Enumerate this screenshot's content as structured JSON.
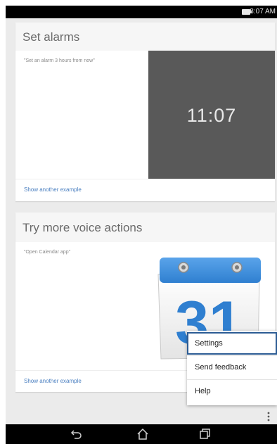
{
  "status_bar": {
    "time": "8:07 AM"
  },
  "cards": {
    "alarms": {
      "title": "Set alarms",
      "example": "\"Set an alarm 3 hours from now\"",
      "clock": "11:07",
      "footer_link": "Show another example"
    },
    "voice_actions": {
      "title": "Try more voice actions",
      "example": "\"Open Calendar app\"",
      "calendar_day": "31",
      "footer_link": "Show another example"
    }
  },
  "menu": {
    "items": [
      "Settings",
      "Send feedback",
      "Help"
    ],
    "selected_index": 0
  },
  "icons": {
    "battery": "battery-icon",
    "overflow": "overflow-menu-icon",
    "back": "back-icon",
    "home": "home-icon",
    "recents": "recents-icon",
    "calendar": "calendar-icon"
  },
  "colors": {
    "link": "#4a7fc0",
    "clock_panel": "#595959",
    "menu_highlight": "#2c5c94",
    "calendar_blue": "#2f7fd0"
  }
}
